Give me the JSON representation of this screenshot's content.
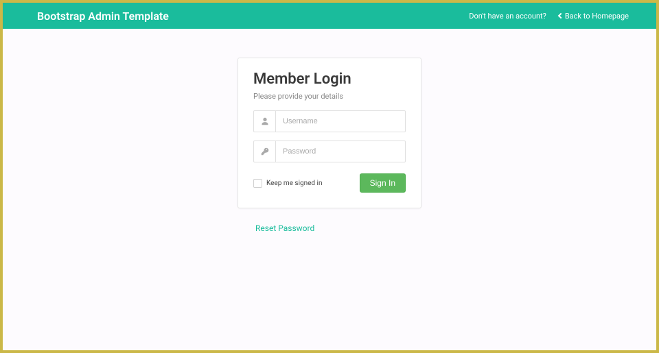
{
  "header": {
    "brand": "Bootstrap Admin Template",
    "account_link": "Don't have an account?",
    "back_link": "Back to Homepage"
  },
  "login": {
    "title": "Member Login",
    "subtitle": "Please provide your details",
    "username_placeholder": "Username",
    "password_placeholder": "Password",
    "keep_signed_in": "Keep me signed in",
    "signin_button": "Sign In",
    "reset_link": "Reset Password"
  }
}
